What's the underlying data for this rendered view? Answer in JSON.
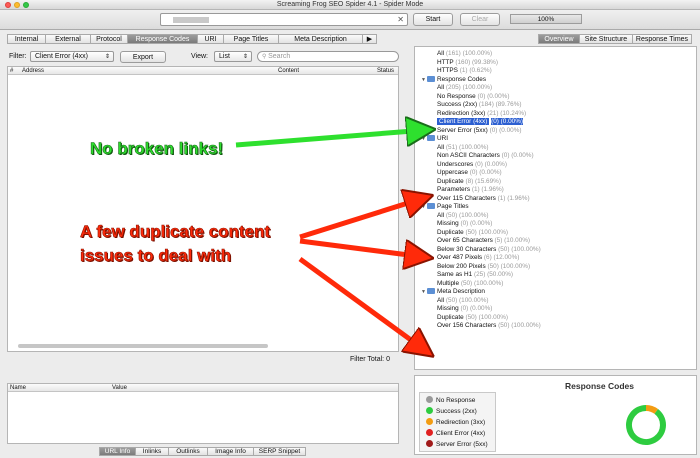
{
  "window": {
    "title": "Screaming Frog SEO Spider 4.1 - Spider Mode"
  },
  "toolbar": {
    "start_label": "Start",
    "clear_label": "Clear",
    "progress_label": "100%",
    "progress_value": 1.0
  },
  "left_tabs": [
    "Internal",
    "External",
    "Protocol",
    "Response Codes",
    "URI",
    "Page Titles",
    "Meta Description"
  ],
  "left_tabs_active": "Response Codes",
  "filter": {
    "label": "Filter:",
    "value": "Client Error (4xx)",
    "export_label": "Export",
    "view_label": "View:",
    "view_value": "List",
    "search_placeholder": "Search"
  },
  "table": {
    "columns": [
      "Address",
      "Content",
      "Status"
    ],
    "filter_total_label": "Filter Total:",
    "filter_total_value": "0"
  },
  "detail_table": {
    "columns": [
      "Name",
      "Value"
    ]
  },
  "bottom_tabs": [
    "URL Info",
    "Inlinks",
    "Outlinks",
    "Image Info",
    "SERP Snippet"
  ],
  "bottom_tabs_active": "URL Info",
  "right_tabs": [
    "Overview",
    "Site Structure",
    "Response Times"
  ],
  "right_tabs_active": "Overview",
  "tree": [
    {
      "label": "All",
      "count": "(161) (100.00%)",
      "folder": false
    },
    {
      "label": "HTTP",
      "count": "(160) (99.38%)",
      "folder": false
    },
    {
      "label": "HTTPS",
      "count": "(1) (0.62%)",
      "folder": false
    },
    {
      "label": "Response Codes",
      "count": "",
      "folder": true
    },
    {
      "label": "All",
      "count": "(205) (100.00%)",
      "folder": false
    },
    {
      "label": "No Response",
      "count": "(0) (0.00%)",
      "folder": false
    },
    {
      "label": "Success (2xx)",
      "count": "(184) (89.76%)",
      "folder": false
    },
    {
      "label": "Redirection (3xx)",
      "count": "(21) (10.24%)",
      "folder": false
    },
    {
      "label": "Client Error (4xx)",
      "count": "(0) (0.00%)",
      "folder": false,
      "selected": true
    },
    {
      "label": "Server Error (5xx)",
      "count": "(0) (0.00%)",
      "folder": false
    },
    {
      "label": "URI",
      "count": "",
      "folder": true
    },
    {
      "label": "All",
      "count": "(51) (100.00%)",
      "folder": false
    },
    {
      "label": "Non ASCII Characters",
      "count": "(0) (0.00%)",
      "folder": false
    },
    {
      "label": "Underscores",
      "count": "(0) (0.00%)",
      "folder": false
    },
    {
      "label": "Uppercase",
      "count": "(0) (0.00%)",
      "folder": false
    },
    {
      "label": "Duplicate",
      "count": "(8) (15.69%)",
      "folder": false
    },
    {
      "label": "Parameters",
      "count": "(1) (1.96%)",
      "folder": false
    },
    {
      "label": "Over 115 Characters",
      "count": "(1) (1.96%)",
      "folder": false
    },
    {
      "label": "Page Titles",
      "count": "",
      "folder": true
    },
    {
      "label": "All",
      "count": "(50) (100.00%)",
      "folder": false
    },
    {
      "label": "Missing",
      "count": "(0) (0.00%)",
      "folder": false
    },
    {
      "label": "Duplicate",
      "count": "(50) (100.00%)",
      "folder": false
    },
    {
      "label": "Over 65 Characters",
      "count": "(5) (10.00%)",
      "folder": false
    },
    {
      "label": "Below 30 Characters",
      "count": "(50) (100.00%)",
      "folder": false
    },
    {
      "label": "Over 487 Pixels",
      "count": "(6) (12.00%)",
      "folder": false
    },
    {
      "label": "Below 200 Pixels",
      "count": "(50) (100.00%)",
      "folder": false
    },
    {
      "label": "Same as H1",
      "count": "(25) (50.00%)",
      "folder": false
    },
    {
      "label": "Multiple",
      "count": "(50) (100.00%)",
      "folder": false
    },
    {
      "label": "Meta Description",
      "count": "",
      "folder": true
    },
    {
      "label": "All",
      "count": "(50) (100.00%)",
      "folder": false
    },
    {
      "label": "Missing",
      "count": "(0) (0.00%)",
      "folder": false
    },
    {
      "label": "Duplicate",
      "count": "(50) (100.00%)",
      "folder": false
    },
    {
      "label": "Over 156 Characters",
      "count": "(50) (100.00%)",
      "folder": false
    }
  ],
  "response_chart": {
    "title": "Response Codes",
    "legend": [
      {
        "label": "No Response",
        "color": "#9a9a9a"
      },
      {
        "label": "Success (2xx)",
        "color": "#2ecc40"
      },
      {
        "label": "Redirection (3xx)",
        "color": "#f39c12"
      },
      {
        "label": "Client Error (4xx)",
        "color": "#e02020"
      },
      {
        "label": "Server Error (5xx)",
        "color": "#a11a1a"
      }
    ],
    "slices": [
      {
        "label": "Success (2xx)",
        "value": 184,
        "color": "#2ecc40"
      },
      {
        "label": "Redirection (3xx)",
        "value": 21,
        "color": "#f39c12"
      }
    ]
  },
  "annotations": {
    "green": "No broken links!",
    "red_line1": "A few duplicate content",
    "red_line2": "issues to deal with",
    "green_color": "#2ee02e",
    "red_color": "#ff2a0a"
  }
}
